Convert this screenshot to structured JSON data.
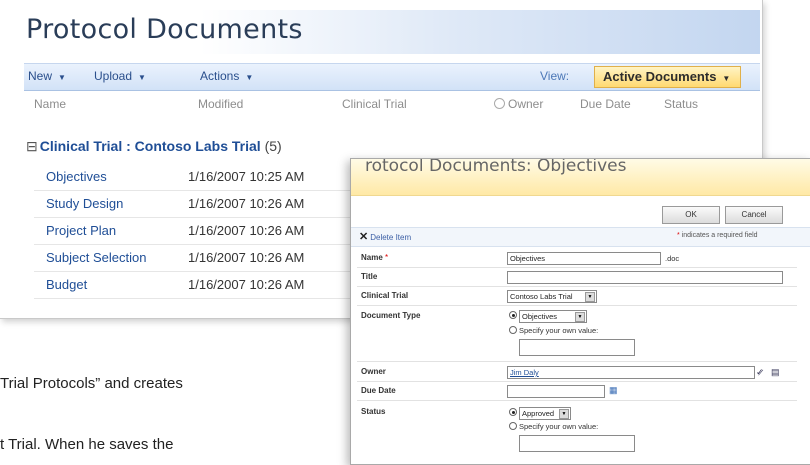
{
  "library": {
    "title": "Protocol Documents",
    "toolbar": {
      "new_label": "New",
      "upload_label": "Upload",
      "actions_label": "Actions",
      "view_label": "View:",
      "view_value": "Active Documents"
    },
    "columns": [
      "Name",
      "Modified",
      "Clinical Trial",
      "Owner",
      "Due Date",
      "Status"
    ],
    "group": {
      "label": "Clinical Trial : Contoso Labs Trial",
      "count": "(5)"
    },
    "rows": [
      {
        "name": "Objectives",
        "modified": "1/16/2007 10:25 AM"
      },
      {
        "name": "Study Design",
        "modified": "1/16/2007 10:26 AM"
      },
      {
        "name": "Project Plan",
        "modified": "1/16/2007 10:26 AM"
      },
      {
        "name": "Subject Selection",
        "modified": "1/16/2007 10:26 AM"
      },
      {
        "name": "Budget",
        "modified": "1/16/2007 10:26 AM"
      }
    ]
  },
  "form": {
    "title": "rotocol Documents: Objectives",
    "ok_label": "OK",
    "cancel_label": "Cancel",
    "delete_label": "Delete Item",
    "required_note": "indicates a required field",
    "fields": {
      "name_label": "Name",
      "name_value": "Objectives",
      "name_ext": ".doc",
      "title_label": "Title",
      "title_value": "",
      "clinical_trial_label": "Clinical Trial",
      "clinical_trial_value": "Contoso Labs Trial",
      "document_type_label": "Document Type",
      "document_type_value": "Objectives",
      "specify_own_value": "Specify your own value:",
      "owner_label": "Owner",
      "owner_value": "Jim Daly",
      "due_date_label": "Due Date",
      "due_date_value": "",
      "status_label": "Status",
      "status_value": "Approved",
      "status_specify": "Specify your own value:"
    }
  },
  "caption": {
    "line1": "Trial Protocols” and creates",
    "line2": "t Trial.  When he saves the"
  },
  "colors": {
    "accent_blue": "#1f4e96",
    "view_highlight": "#ffd971",
    "form_title_bar": "#ffe9a6"
  }
}
